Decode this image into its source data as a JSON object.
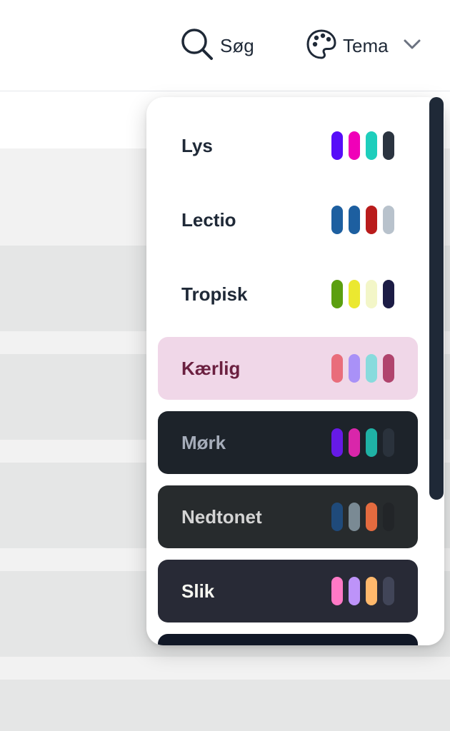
{
  "header": {
    "search_label": "Søg",
    "theme_label": "Tema"
  },
  "themes": [
    {
      "name": "Lys",
      "bg": "#ffffff",
      "fg": "#1f2937",
      "colors": [
        "#570df8",
        "#f000b8",
        "#1ecebc",
        "#2b3440"
      ]
    },
    {
      "name": "Lectio",
      "bg": "#ffffff",
      "fg": "#1f2937",
      "colors": [
        "#1d5fa0",
        "#1d5fa0",
        "#b91c1c",
        "#b8c2cc"
      ]
    },
    {
      "name": "Tropisk",
      "bg": "#ffffff",
      "fg": "#1f2937",
      "colors": [
        "#5b9f10",
        "#ebe830",
        "#f3f6c8",
        "#1c1c45"
      ]
    },
    {
      "name": "Kærlig",
      "bg": "#f0d7e8",
      "fg": "#6b2040",
      "colors": [
        "#e96d7b",
        "#a991f7",
        "#88dbdd",
        "#b0446d"
      ]
    },
    {
      "name": "Mørk",
      "bg": "#1d232a",
      "fg": "#a6adba",
      "colors": [
        "#661ae6",
        "#d926aa",
        "#1fb2a5",
        "#2a323c"
      ]
    },
    {
      "name": "Nedtonet",
      "bg": "#272b2d",
      "fg": "#d4d4d4",
      "colors": [
        "#1f4a7a",
        "#7a8a94",
        "#e46b3f",
        "#222528"
      ]
    },
    {
      "name": "Slik",
      "bg": "#282a36",
      "fg": "#f8f8f2",
      "colors": [
        "#ff79c6",
        "#bd93f9",
        "#ffb86c",
        "#414558"
      ]
    }
  ]
}
